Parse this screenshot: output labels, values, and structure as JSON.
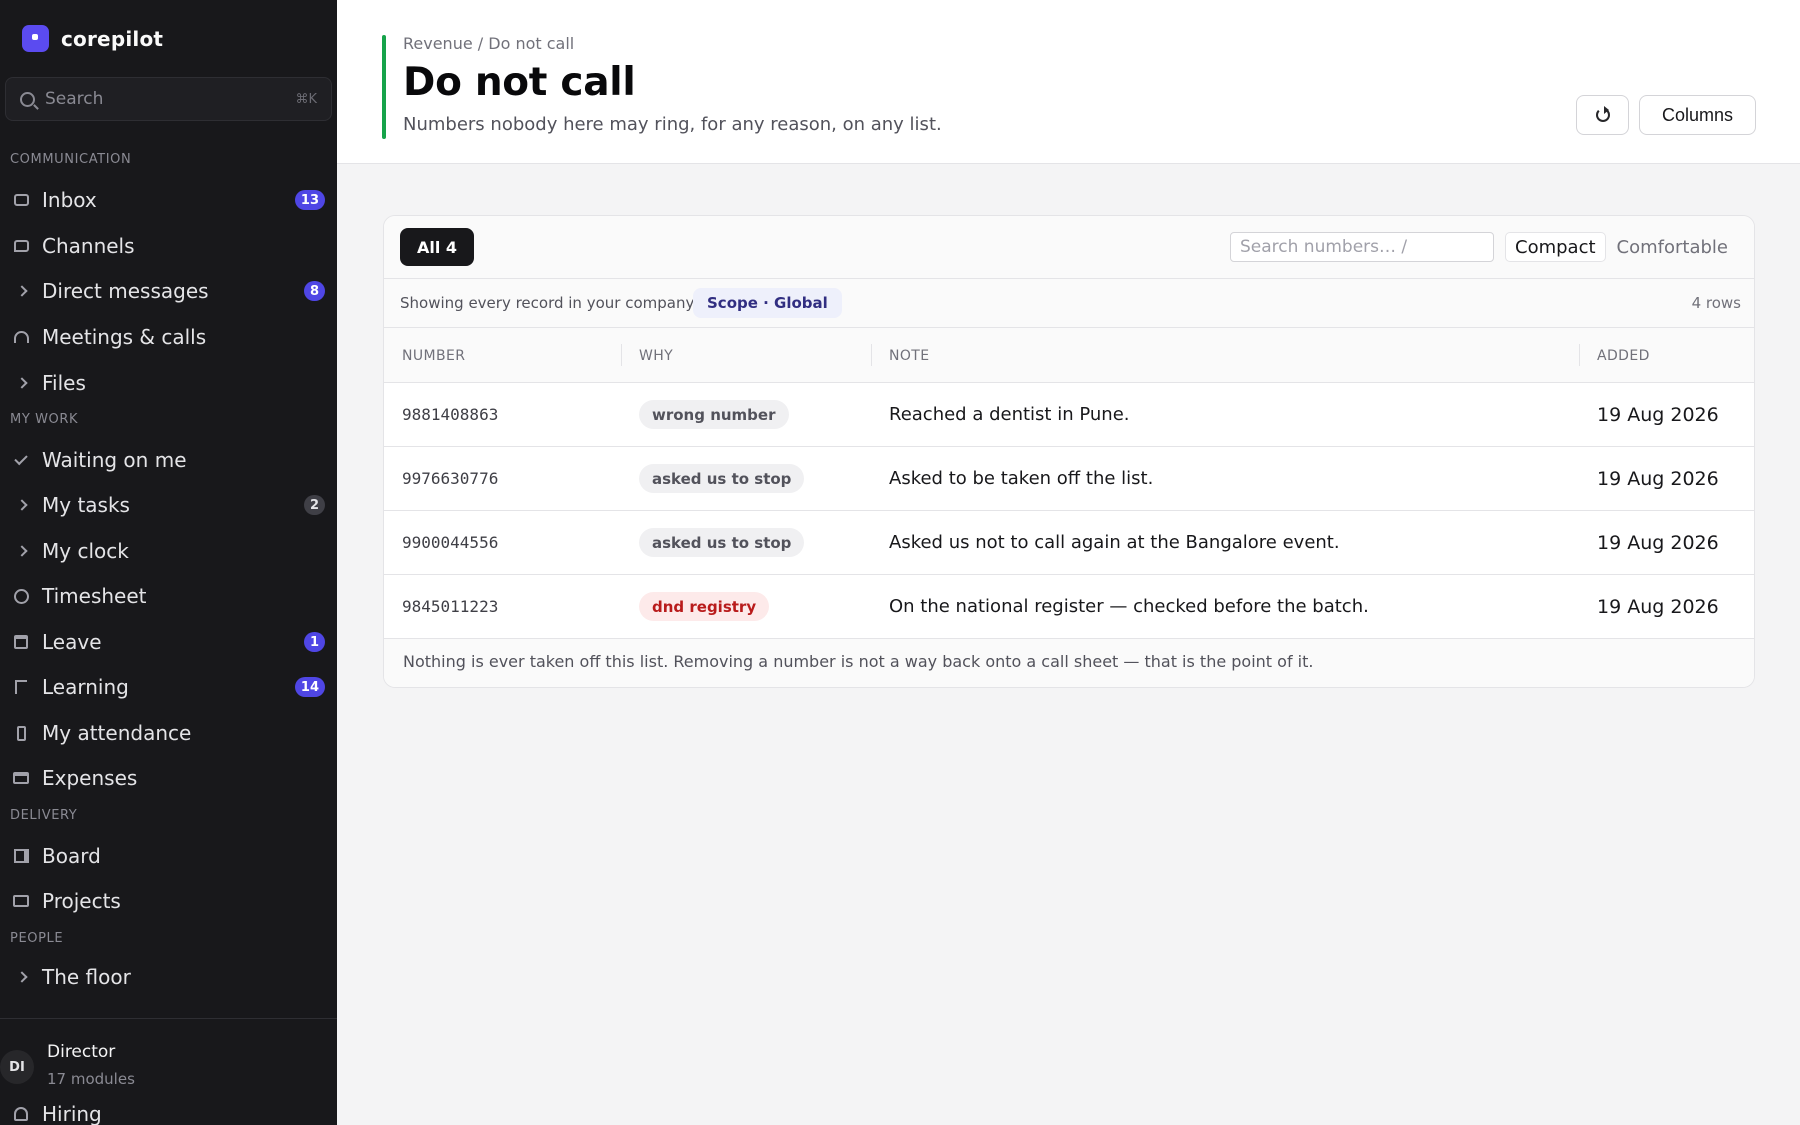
{
  "brand": {
    "name": "corepilot"
  },
  "search": {
    "placeholder": "Search",
    "shortcut": "⌘K"
  },
  "sidebar": {
    "sections": {
      "communication": "COMMUNICATION",
      "my_work": "MY WORK",
      "delivery": "DELIVERY",
      "people": "PEOPLE"
    },
    "items": [
      {
        "label": "Inbox",
        "icon": "inbox-icon",
        "badge": "13"
      },
      {
        "label": "Channels",
        "icon": "chat-icon"
      },
      {
        "label": "Direct messages",
        "icon": "chevron-right-icon",
        "badge": "8"
      },
      {
        "label": "Meetings & calls",
        "icon": "headset-icon"
      },
      {
        "label": "Files",
        "icon": "chevron-right-icon"
      },
      {
        "label": "Waiting on me",
        "icon": "check-icon"
      },
      {
        "label": "My tasks",
        "icon": "chevron-right-icon",
        "badge": "2"
      },
      {
        "label": "My clock",
        "icon": "chevron-right-icon"
      },
      {
        "label": "Timesheet",
        "icon": "clock-icon"
      },
      {
        "label": "Leave",
        "icon": "calendar-icon",
        "badge": "1"
      },
      {
        "label": "Learning",
        "icon": "flag-icon",
        "badge": "14"
      },
      {
        "label": "My attendance",
        "icon": "phone-icon"
      },
      {
        "label": "Expenses",
        "icon": "card-icon"
      },
      {
        "label": "Board",
        "icon": "board-icon"
      },
      {
        "label": "Projects",
        "icon": "briefcase-icon"
      },
      {
        "label": "The floor",
        "icon": "chevron-right-icon"
      },
      {
        "label": "Hiring",
        "icon": "user-icon"
      }
    ],
    "user": {
      "initials": "DI",
      "name": "Director",
      "sub": "17 modules"
    }
  },
  "header": {
    "breadcrumb": "Revenue / Do not call",
    "title": "Do not call",
    "subtitle": "Numbers nobody here may ring, for any reason, on any list.",
    "columns_label": "Columns"
  },
  "toolbar": {
    "tab_all": "All 4",
    "search_placeholder": "Search numbers…  /",
    "density": [
      "Compact",
      "Comfortable"
    ],
    "density_selected": "Compact"
  },
  "scope": {
    "text": "Showing every record in your company",
    "pill": "Scope · Global",
    "count": "4 rows"
  },
  "table": {
    "columns": [
      "NUMBER",
      "WHY",
      "NOTE",
      "ADDED"
    ],
    "rows": [
      {
        "number": "9881408863",
        "why": "wrong number",
        "note": "Reached a dentist in Pune.",
        "added": "19 Aug 2026"
      },
      {
        "number": "9976630776",
        "why": "asked us to stop",
        "note": "Asked to be taken off the list.",
        "added": "19 Aug 2026"
      },
      {
        "number": "9900044556",
        "why": "asked us to stop",
        "note": "Asked us not to call again at the Bangalore event.",
        "added": "19 Aug 2026"
      },
      {
        "number": "9845011223",
        "why": "dnd registry",
        "note": "On the national register — checked before the batch.",
        "added": "19 Aug 2026"
      }
    ],
    "footer": "Nothing is ever taken off this list. Removing a number is not a way back onto a call sheet — that is the point of it."
  },
  "colors": {
    "accent": "#4f46e5",
    "success": "#16a34a",
    "danger": "#b91c1c",
    "sidebar_bg": "#18181b"
  }
}
